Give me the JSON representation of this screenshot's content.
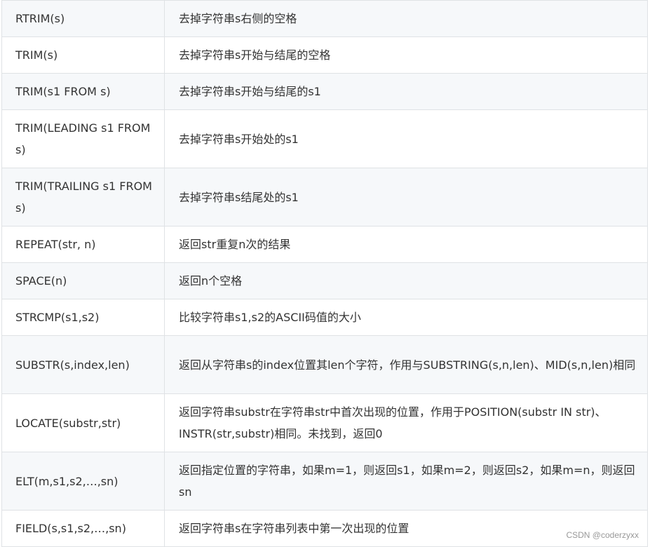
{
  "rows": [
    {
      "fn": "RTRIM(s)",
      "desc": "去掉字符串s右侧的空格"
    },
    {
      "fn": "TRIM(s)",
      "desc": "去掉字符串s开始与结尾的空格"
    },
    {
      "fn": "TRIM(s1 FROM s)",
      "desc": "去掉字符串s开始与结尾的s1"
    },
    {
      "fn": "TRIM(LEADING s1 FROM s)",
      "desc": "去掉字符串s开始处的s1"
    },
    {
      "fn": "TRIM(TRAILING s1 FROM s)",
      "desc": "去掉字符串s结尾处的s1"
    },
    {
      "fn": "REPEAT(str, n)",
      "desc": "返回str重复n次的结果"
    },
    {
      "fn": "SPACE(n)",
      "desc": "返回n个空格"
    },
    {
      "fn": "STRCMP(s1,s2)",
      "desc": "比较字符串s1,s2的ASCII码值的大小"
    },
    {
      "fn": "SUBSTR(s,index,len)",
      "desc": "返回从字符串s的index位置其len个字符，作用与SUBSTRING(s,n,len)、MID(s,n,len)相同"
    },
    {
      "fn": "LOCATE(substr,str)",
      "desc": "返回字符串substr在字符串str中首次出现的位置，作用于POSITION(substr IN str)、INSTR(str,substr)相同。未找到，返回0"
    },
    {
      "fn": "ELT(m,s1,s2,…,sn)",
      "desc": "返回指定位置的字符串，如果m=1，则返回s1，如果m=2，则返回s2，如果m=n，则返回sn"
    },
    {
      "fn": "FIELD(s,s1,s2,…,sn)",
      "desc": "返回字符串s在字符串列表中第一次出现的位置"
    }
  ],
  "watermark": "CSDN @coderzyxx"
}
